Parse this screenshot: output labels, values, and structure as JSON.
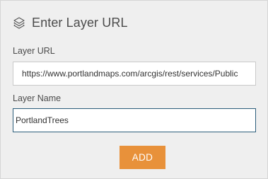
{
  "dialog": {
    "title": "Enter Layer URL",
    "icon": "layers-icon"
  },
  "url_field": {
    "label": "Layer URL",
    "value": "https://www.portlandmaps.com/arcgis/rest/services/Public"
  },
  "name_field": {
    "label": "Layer Name",
    "value": "PortlandTrees"
  },
  "add_button": {
    "label": "ADD"
  },
  "colors": {
    "accent": "#e8913a",
    "focus_border": "#2b5c7a"
  }
}
